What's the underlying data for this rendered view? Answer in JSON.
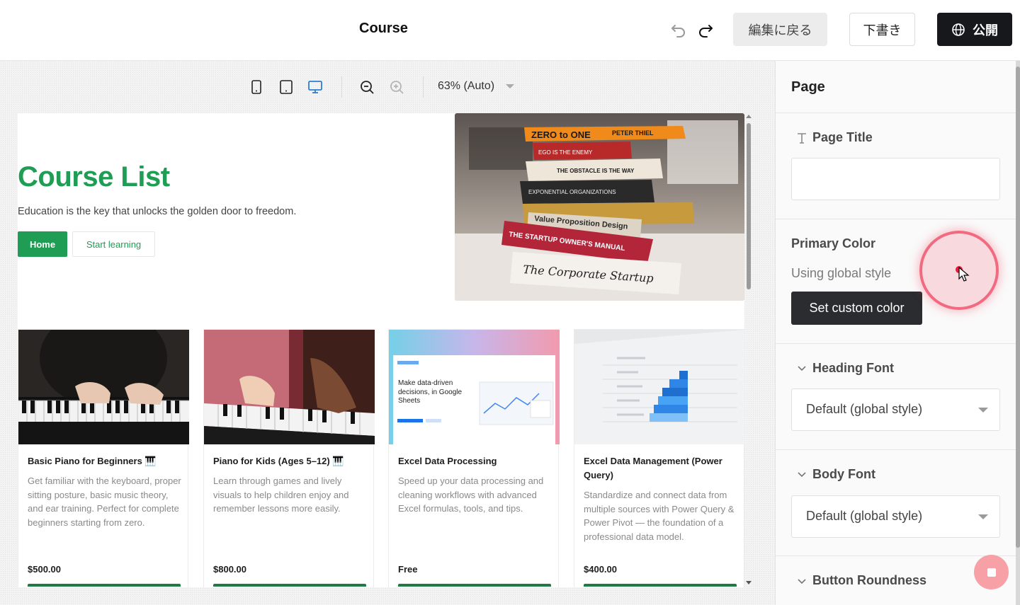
{
  "topbar": {
    "title": "Course",
    "back_label": "編集に戻る",
    "draft_label": "下書き",
    "publish_label": "公開"
  },
  "canvas": {
    "zoom_label": "63% (Auto)"
  },
  "hero": {
    "title": "Course List",
    "subtitle": "Education is the key that unlocks the golden door to freedom.",
    "home_label": "Home",
    "start_label": "Start learning",
    "book_titles": [
      "ZERO to ONE",
      "PETER THIEL",
      "EGO IS THE ENEMY",
      "THE OBSTACLE IS THE WAY",
      "EXPONENTIAL ORGANIZATIONS",
      "Value Proposition Design",
      "THE STARTUP OWNER'S MANUAL",
      "The Corporate Startup"
    ]
  },
  "courses": [
    {
      "title": "Basic Piano for Beginners 🎹",
      "description": "Get familiar with the keyboard, proper sitting posture, basic music theory, and ear training. Perfect for complete beginners starting from zero.",
      "price": "$500.00"
    },
    {
      "title": "Piano for Kids (Ages 5–12) 🎹",
      "description": "Learn through games and lively visuals to help children enjoy and remember lessons more easily.",
      "price": "$800.00"
    },
    {
      "title": "Excel Data Processing",
      "description": "Speed up your data processing and cleaning workflows with advanced Excel formulas, tools, and tips.",
      "price": "Free",
      "thumb_text": "Make data-driven decisions, in Google Sheets"
    },
    {
      "title": "Excel Data Management (Power Query)",
      "description": "Standardize and connect data from multiple sources with Power Query & Power Pivot — the foundation of a professional data model.",
      "price": "$400.00"
    }
  ],
  "panel": {
    "title": "Page",
    "page_title_label": "Page Title",
    "page_title_value": "",
    "primary_color_label": "Primary Color",
    "primary_color_status": "Using global style",
    "set_custom_label": "Set custom color",
    "heading_font_label": "Heading Font",
    "heading_font_value": "Default (global style)",
    "body_font_label": "Body Font",
    "body_font_value": "Default (global style)",
    "button_roundness_label": "Button Roundness"
  },
  "colors": {
    "brand_green": "#1f9d55",
    "publish_bg": "#16181b",
    "click_indicator": "#e8193c"
  }
}
